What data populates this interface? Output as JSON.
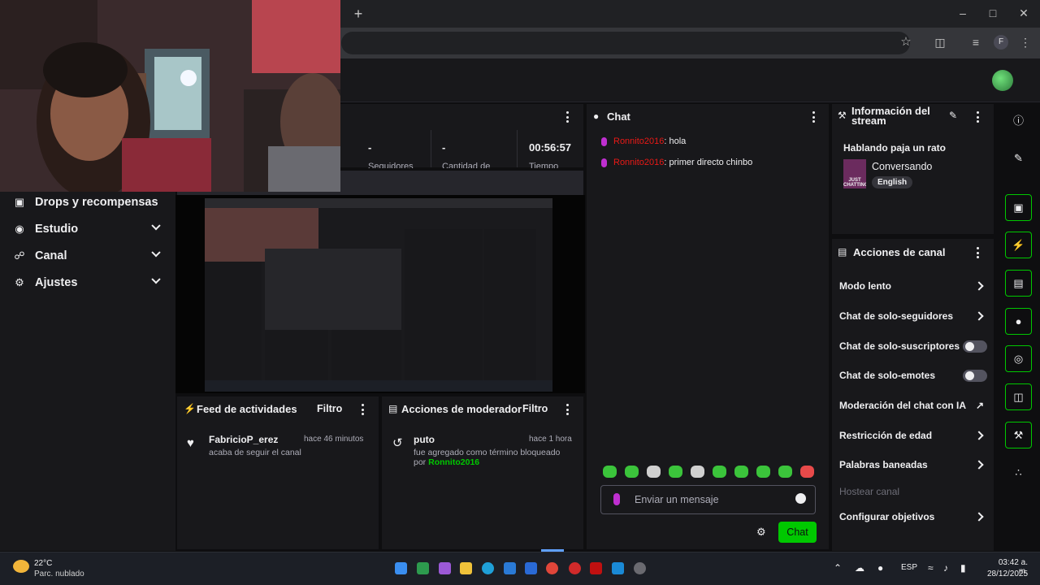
{
  "browser": {
    "new_tab": "+",
    "profile_initial": "F",
    "window_controls": [
      "minimize",
      "maximize",
      "close"
    ]
  },
  "sidebar": {
    "items": [
      {
        "label": "Drops y recompensas",
        "icon": "gift-icon",
        "expandable": false
      },
      {
        "label": "Estudio",
        "icon": "studio-icon",
        "expandable": true
      },
      {
        "label": "Canal",
        "icon": "channel-icon",
        "expandable": true
      },
      {
        "label": "Ajustes",
        "icon": "gear-icon",
        "expandable": true
      }
    ]
  },
  "stats": {
    "values": [
      "-",
      "-",
      "00:56:57"
    ],
    "labels": [
      "Seguidores",
      "Cantidad de",
      "Tiempo"
    ]
  },
  "feed": {
    "title": "Feed de actividades",
    "filter": "Filtro",
    "items": [
      {
        "name": "FabricioP_erez",
        "time": "hace 46 minutos",
        "text": "acaba de seguir el canal"
      }
    ]
  },
  "moderator": {
    "title": "Acciones de moderador",
    "filter": "Filtro",
    "items": [
      {
        "name": "puto",
        "time": "hace 1 hora",
        "text": "fue agregado como término bloqueado",
        "by_prefix": "por",
        "by_user": "Ronnito2016"
      }
    ]
  },
  "chat": {
    "title": "Chat",
    "messages": [
      {
        "user": "Ronnito2016",
        "text": ": hola"
      },
      {
        "user": "Ronnito2016",
        "text": ": primer directo chinbo"
      }
    ],
    "input_placeholder": "Enviar un mensaje",
    "send_label": "Chat"
  },
  "stream_info": {
    "title": "Información del stream",
    "stream_title": "Hablando paja un rato",
    "category": "Conversando",
    "category_art_text": "JUST CHATTING",
    "language": "English"
  },
  "channel_actions": {
    "title": "Acciones de canal",
    "items": [
      {
        "label": "Modo lento",
        "control": "arrow"
      },
      {
        "label": "Chat de solo-seguidores",
        "control": "arrow"
      },
      {
        "label": "Chat de solo-suscriptores",
        "control": "toggle",
        "value": false
      },
      {
        "label": "Chat de solo-emotes",
        "control": "toggle",
        "value": false
      },
      {
        "label": "Moderación del chat con IA",
        "control": "external"
      },
      {
        "label": "Restricción de edad",
        "control": "arrow"
      },
      {
        "label": "Palabras baneadas",
        "control": "arrow"
      },
      {
        "label": "Hostear canal",
        "control": "none",
        "disabled": true
      },
      {
        "label": "Configurar objetivos",
        "control": "arrow"
      }
    ]
  },
  "rail": {
    "icons": [
      "info-icon",
      "pencil-icon",
      "camera-frame-icon",
      "lightning-icon",
      "document-icon",
      "chat-bubble-icon",
      "broadcast-icon",
      "layout-icon",
      "wrench-icon",
      "connections-icon"
    ]
  },
  "taskbar": {
    "temperature": "22°C",
    "weather": "Parc. nublado",
    "language": "ESP",
    "time": "03:42 a. m.",
    "date": "28/12/2025"
  },
  "colors": {
    "accent": "#00c800",
    "chat_user": "#e91916",
    "background": "#0e0e10",
    "panel": "#18181b"
  }
}
